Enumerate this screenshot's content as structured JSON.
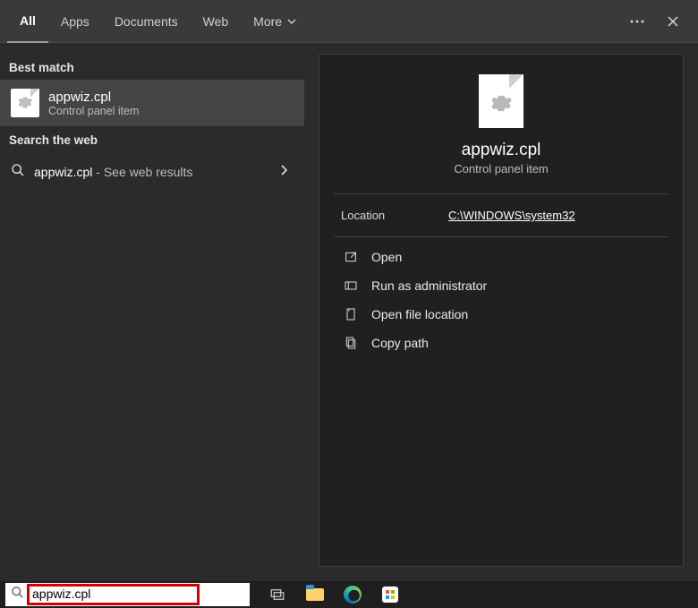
{
  "tabs": {
    "all": "All",
    "apps": "Apps",
    "documents": "Documents",
    "web": "Web",
    "more": "More"
  },
  "left": {
    "best_match_label": "Best match",
    "best_match": {
      "title": "appwiz.cpl",
      "subtitle": "Control panel item"
    },
    "search_web_label": "Search the web",
    "web_result": {
      "term": "appwiz.cpl",
      "tail": " - See web results"
    }
  },
  "preview": {
    "title": "appwiz.cpl",
    "subtitle": "Control panel item",
    "location_label": "Location",
    "location_value": "C:\\WINDOWS\\system32",
    "actions": {
      "open": "Open",
      "run_admin": "Run as administrator",
      "open_loc": "Open file location",
      "copy_path": "Copy path"
    }
  },
  "search_input": "appwiz.cpl"
}
